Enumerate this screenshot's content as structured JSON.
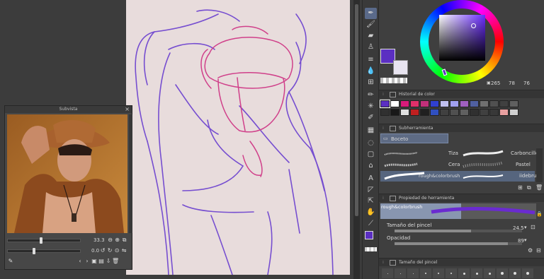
{
  "subview": {
    "title": "Subvista",
    "close_glyph": "×",
    "zoom_value": "33.3",
    "rotation_value": "0.0"
  },
  "color_wheel": {
    "main_color": "#5b2fc2",
    "sub_color": "#e8e4f0",
    "hue_readout": "265",
    "sat_readout": "78",
    "val_readout": "76"
  },
  "color_history": {
    "title": "Historial de color",
    "swatches_row1": [
      "#5b2fc2",
      "#ffffff",
      "#d81b7a",
      "#e0306a",
      "#c2307a",
      "#3040d0",
      "#c0c0f0",
      "#a0a0f0",
      "#a060c0",
      "#5060a0",
      "#707070",
      "#505050",
      "#404040",
      "#606060"
    ],
    "swatches_row2": [
      "#303030",
      "#181818",
      "#e0e0e0",
      "#c02020",
      "#202020",
      "#3050c0",
      "#404040",
      "#505050",
      "#606060",
      "#303030",
      "#404040",
      "#383838",
      "#e8a0a0",
      "#d0d0d0"
    ]
  },
  "sub_tool": {
    "title": "Subherramienta",
    "group_label": "Boceto",
    "brushes": [
      {
        "left": "Tiza",
        "right": "Carboncillo"
      },
      {
        "left": "Cera",
        "right": "Pastel"
      },
      {
        "left": "rough&colorbrush",
        "right": "iidebrush"
      }
    ]
  },
  "tool_property": {
    "title": "Propiedad de herramienta",
    "brush_name": "rough&colorbrush",
    "brush_size_label": "Tamaño del pincel",
    "brush_size_value": "24.5",
    "opacity_label": "Opacidad",
    "opacity_value": "89"
  },
  "brush_size_panel": {
    "title": "Tamaño del pincel"
  },
  "icons": {
    "subview_close": "close-icon",
    "eyedropper": "eyedropper-icon"
  }
}
